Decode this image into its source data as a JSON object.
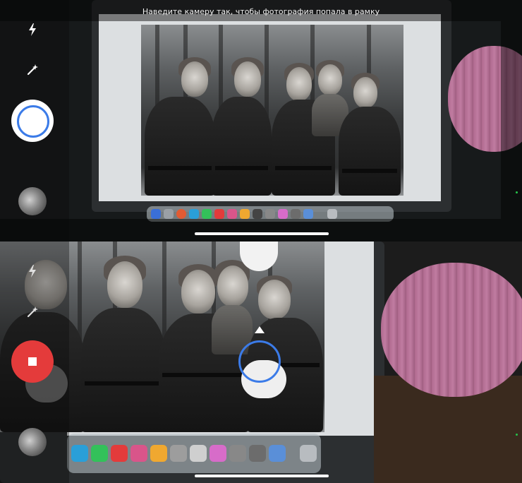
{
  "camera_hint": "Наведите камеру так, чтобы фотография попала в рамку",
  "icons": {
    "flash": "flash-icon",
    "magic": "magic-wand-icon",
    "shutter": "shutter-button",
    "stop": "stop-icon",
    "gallery": "gallery-thumbnail"
  },
  "colors": {
    "shutter_ring": "#3b7be8",
    "record_red": "#e43b3b",
    "status_green": "#26c24b"
  }
}
